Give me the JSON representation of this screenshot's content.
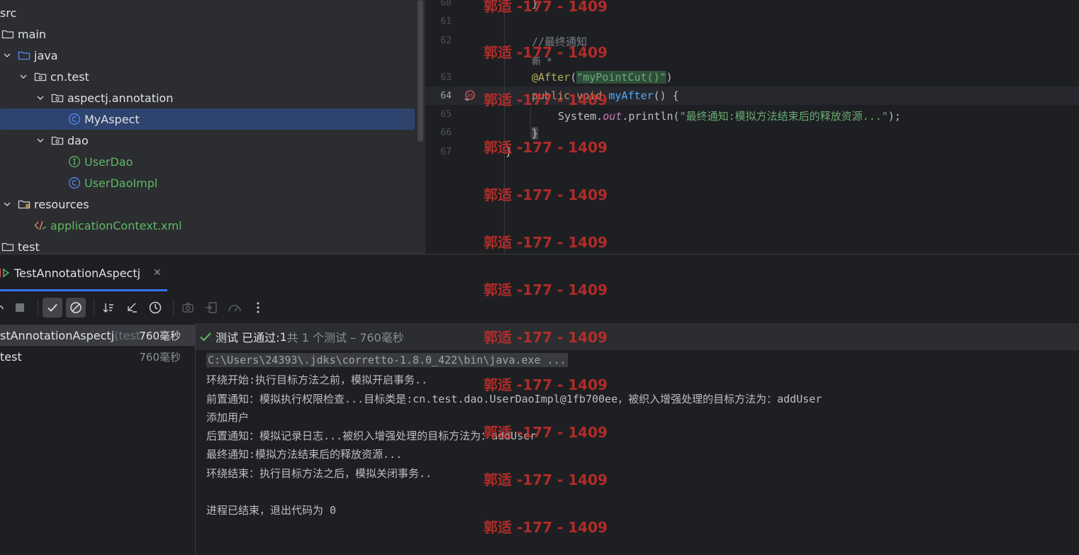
{
  "project_tree": {
    "items": [
      {
        "label": "src"
      },
      {
        "label": "main"
      },
      {
        "label": "java"
      },
      {
        "label": "cn.test"
      },
      {
        "label": "aspectj.annotation"
      },
      {
        "label": "MyAspect"
      },
      {
        "label": "dao"
      },
      {
        "label": "UserDao"
      },
      {
        "label": "UserDaoImpl"
      },
      {
        "label": "resources"
      },
      {
        "label": "applicationContext.xml"
      },
      {
        "label": "test"
      }
    ]
  },
  "editor": {
    "line_numbers": [
      "60",
      "61",
      "62",
      "63",
      "64",
      "65",
      "66",
      "67"
    ],
    "comment": "//最终通知",
    "hint": "新 *",
    "annotation": "@After",
    "annotation_arg": "\"myPointCut()\"",
    "kw_public": "public",
    "kw_void": "void",
    "method_name": "myAfter",
    "method_tail": "() {",
    "println_prefix": "System.",
    "println_static": "out",
    "println_call": ".println(",
    "println_string": "\"最终通知:模拟方法结束后的释放资源...\"",
    "println_end": ");",
    "close_brace_inner": "}",
    "close_brace_outer": "}",
    "top_brace": "}"
  },
  "run_panel": {
    "tab_label": "TestAnnotationAspectj",
    "test_tree": [
      {
        "label": "stAnnotationAspectj",
        "suffix": " (test",
        "time": "760毫秒"
      },
      {
        "label": "test",
        "suffix": "",
        "time": "760毫秒"
      }
    ],
    "status": {
      "prefix": "测试 已通过: ",
      "passed": "1",
      "detail": "共 1 个测试 – 760毫秒"
    },
    "console_lines": [
      "C:\\Users\\24393\\.jdks\\corretto-1.8.0_422\\bin\\java.exe ...",
      "环绕开始:执行目标方法之前，模拟开启事务..",
      "前置通知：模拟执行权限检查...目标类是:cn.test.dao.UserDaoImpl@1fb700ee，被织入增强处理的目标方法为：addUser",
      "添加用户",
      "后置通知：模拟记录日志...被织入增强处理的目标方法为：addUser",
      "最终通知:模拟方法结束后的释放资源...",
      "环绕结束：执行目标方法之后，模拟关闭事务..",
      "",
      "进程已结束，退出代码为 0"
    ]
  },
  "watermark": "郭适 -177 - 1409",
  "colors": {
    "selection": "#2e436e",
    "accent": "#3574f0",
    "watermark": "#c8302b",
    "passed": "#5fb865"
  }
}
